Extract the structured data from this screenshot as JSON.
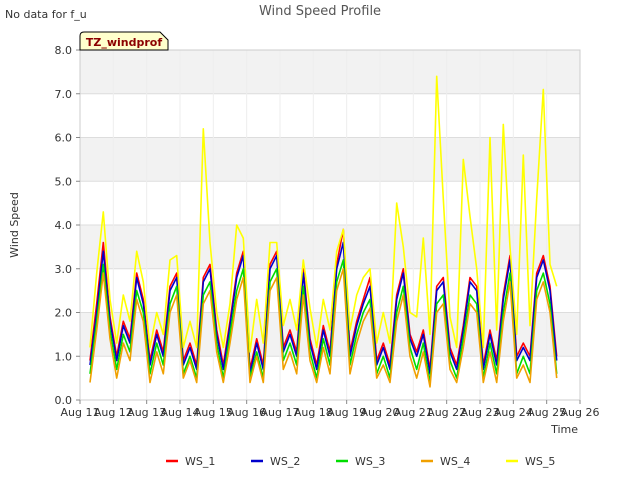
{
  "corner_note": "No data for f_u",
  "chart_data": {
    "type": "line",
    "title": "Wind Speed Profile",
    "xlabel": "Time",
    "ylabel": "Wind Speed",
    "badge": "TZ_windprof",
    "ylim": [
      0.0,
      8.0
    ],
    "xlim": [
      11,
      26
    ],
    "yticks": [
      0.0,
      1.0,
      2.0,
      3.0,
      4.0,
      5.0,
      6.0,
      7.0,
      8.0
    ],
    "ytick_labels": [
      "0.0",
      "1.0",
      "2.0",
      "3.0",
      "4.0",
      "5.0",
      "6.0",
      "7.0",
      "8.0"
    ],
    "xticks": [
      11,
      12,
      13,
      14,
      15,
      16,
      17,
      18,
      19,
      20,
      21,
      22,
      23,
      24,
      25,
      26
    ],
    "xtick_labels": [
      "Aug 11",
      "Aug 12",
      "Aug 13",
      "Aug 14",
      "Aug 15",
      "Aug 16",
      "Aug 17",
      "Aug 18",
      "Aug 19",
      "Aug 20",
      "Aug 21",
      "Aug 22",
      "Aug 23",
      "Aug 24",
      "Aug 25",
      "Aug 26"
    ],
    "grid": true,
    "band_color": "#f2f2f2",
    "legend_position": "bottom-center",
    "x": [
      11.3,
      11.5,
      11.7,
      11.9,
      12.1,
      12.3,
      12.5,
      12.7,
      12.9,
      13.1,
      13.3,
      13.5,
      13.7,
      13.9,
      14.1,
      14.3,
      14.5,
      14.7,
      14.9,
      15.1,
      15.3,
      15.5,
      15.7,
      15.9,
      16.1,
      16.3,
      16.5,
      16.7,
      16.9,
      17.1,
      17.3,
      17.5,
      17.7,
      17.9,
      18.1,
      18.3,
      18.5,
      18.7,
      18.9,
      19.1,
      19.3,
      19.5,
      19.7,
      19.9,
      20.1,
      20.3,
      20.5,
      20.7,
      20.9,
      21.1,
      21.3,
      21.5,
      21.7,
      21.9,
      22.1,
      22.3,
      22.5,
      22.7,
      22.9,
      23.1,
      23.3,
      23.5,
      23.7,
      23.9,
      24.1,
      24.3,
      24.5,
      24.7,
      24.9,
      25.1,
      25.3
    ],
    "series": [
      {
        "name": "WS_1",
        "color": "#ff0000",
        "values": [
          0.9,
          2.2,
          3.6,
          1.9,
          1.0,
          1.8,
          1.4,
          2.9,
          2.3,
          0.9,
          1.6,
          1.1,
          2.6,
          2.9,
          0.9,
          1.3,
          0.8,
          2.8,
          3.1,
          1.6,
          0.8,
          1.8,
          2.9,
          3.4,
          0.7,
          1.4,
          0.8,
          3.1,
          3.4,
          1.2,
          1.6,
          1.1,
          3.0,
          1.4,
          0.8,
          1.7,
          1.1,
          3.1,
          3.9,
          1.1,
          1.8,
          2.3,
          2.8,
          0.9,
          1.3,
          0.8,
          2.4,
          3.0,
          1.5,
          1.1,
          1.6,
          0.7,
          2.6,
          2.8,
          1.2,
          0.8,
          1.7,
          2.8,
          2.6,
          0.8,
          1.6,
          0.9,
          2.4,
          3.3,
          1.0,
          1.3,
          1.0,
          2.9,
          3.3,
          2.6,
          1.0
        ]
      },
      {
        "name": "WS_2",
        "color": "#0000cc",
        "values": [
          0.8,
          2.0,
          3.4,
          1.8,
          0.9,
          1.7,
          1.3,
          2.8,
          2.2,
          0.8,
          1.5,
          1.0,
          2.5,
          2.8,
          0.8,
          1.2,
          0.7,
          2.7,
          3.0,
          1.5,
          0.7,
          1.7,
          2.8,
          3.3,
          0.6,
          1.3,
          0.7,
          3.0,
          3.3,
          1.1,
          1.5,
          1.0,
          2.9,
          1.3,
          0.7,
          1.6,
          1.0,
          3.0,
          3.6,
          1.0,
          1.7,
          2.2,
          2.6,
          0.8,
          1.2,
          0.7,
          2.3,
          2.9,
          1.4,
          1.0,
          1.5,
          0.6,
          2.5,
          2.7,
          1.1,
          0.7,
          1.6,
          2.7,
          2.5,
          0.7,
          1.5,
          0.8,
          2.3,
          3.2,
          0.9,
          1.2,
          0.9,
          2.8,
          3.2,
          2.5,
          0.9
        ]
      },
      {
        "name": "WS_3",
        "color": "#00dd00",
        "values": [
          0.6,
          1.8,
          3.1,
          1.6,
          0.7,
          1.5,
          1.1,
          2.5,
          2.0,
          0.6,
          1.3,
          0.8,
          2.2,
          2.6,
          0.6,
          1.0,
          0.5,
          2.4,
          2.7,
          1.3,
          0.5,
          1.5,
          2.5,
          3.0,
          0.5,
          1.1,
          0.5,
          2.7,
          3.0,
          0.9,
          1.3,
          0.8,
          2.6,
          1.1,
          0.5,
          1.4,
          0.8,
          2.7,
          3.2,
          0.8,
          1.5,
          2.0,
          2.3,
          0.6,
          1.0,
          0.5,
          2.0,
          2.6,
          1.2,
          0.7,
          1.3,
          0.4,
          2.2,
          2.4,
          0.9,
          0.5,
          1.4,
          2.4,
          2.2,
          0.5,
          1.3,
          0.6,
          2.0,
          2.9,
          0.6,
          1.0,
          0.6,
          2.5,
          2.9,
          2.2,
          0.6
        ]
      },
      {
        "name": "WS_4",
        "color": "#f0a000",
        "values": [
          0.4,
          1.6,
          2.9,
          1.4,
          0.5,
          1.3,
          0.9,
          2.3,
          1.8,
          0.4,
          1.1,
          0.6,
          2.0,
          2.4,
          0.5,
          0.9,
          0.4,
          2.2,
          2.5,
          1.1,
          0.4,
          1.3,
          2.3,
          2.8,
          0.4,
          1.0,
          0.4,
          2.5,
          2.8,
          0.7,
          1.1,
          0.6,
          2.4,
          0.9,
          0.4,
          1.2,
          0.6,
          2.5,
          3.0,
          0.6,
          1.3,
          1.8,
          2.1,
          0.5,
          0.8,
          0.4,
          1.8,
          2.4,
          1.0,
          0.5,
          1.1,
          0.3,
          2.0,
          2.2,
          0.7,
          0.4,
          1.2,
          2.2,
          2.0,
          0.4,
          1.1,
          0.4,
          1.8,
          2.7,
          0.5,
          0.8,
          0.4,
          2.3,
          2.7,
          2.0,
          0.5
        ]
      },
      {
        "name": "WS_5",
        "color": "#ffff00",
        "values": [
          1.2,
          2.9,
          4.3,
          2.3,
          1.3,
          2.4,
          1.8,
          3.4,
          2.7,
          1.2,
          2.0,
          1.5,
          3.2,
          3.3,
          1.2,
          1.8,
          1.2,
          6.2,
          3.6,
          2.0,
          1.2,
          2.2,
          4.0,
          3.7,
          1.1,
          2.3,
          1.3,
          3.6,
          3.6,
          1.7,
          2.3,
          1.6,
          3.2,
          2.1,
          1.2,
          2.3,
          1.6,
          3.4,
          3.9,
          1.6,
          2.4,
          2.8,
          3.0,
          1.3,
          2.0,
          1.3,
          4.5,
          3.5,
          2.0,
          1.9,
          3.7,
          1.5,
          7.4,
          4.6,
          1.9,
          1.2,
          5.5,
          4.2,
          3.0,
          1.2,
          6.0,
          1.6,
          6.3,
          3.5,
          1.5,
          5.6,
          1.7,
          4.6,
          7.1,
          3.1,
          2.6
        ]
      }
    ]
  }
}
